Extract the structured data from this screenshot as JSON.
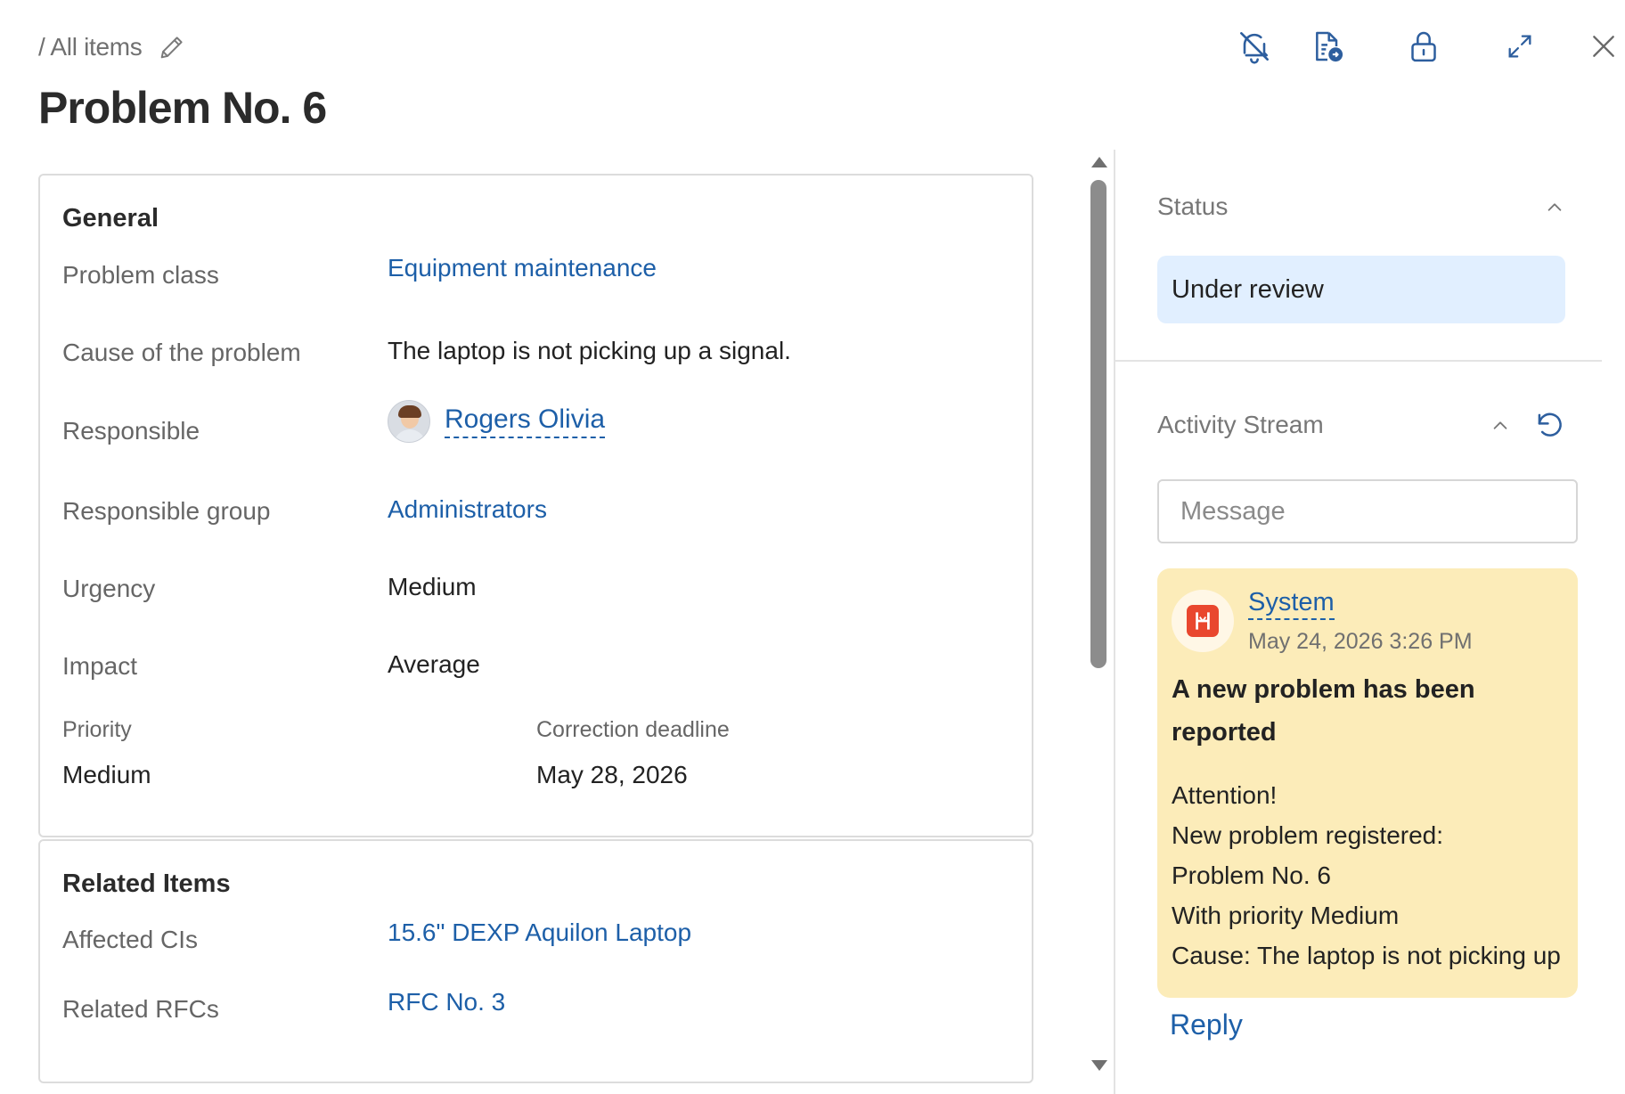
{
  "breadcrumb": {
    "text": "/ All items",
    "edit_icon": "pencil-icon"
  },
  "title": "Problem No. 6",
  "top_actions": [
    "bell-off-icon",
    "file-export-icon",
    "lock-icon",
    "expand-icon",
    "close-icon"
  ],
  "general": {
    "title": "General",
    "problem_class": {
      "label": "Problem class",
      "value": "Equipment maintenance"
    },
    "cause": {
      "label": "Cause of the problem",
      "value": "The laptop is not picking up a signal."
    },
    "responsible": {
      "label": "Responsible",
      "value": "Rogers Olivia"
    },
    "responsible_group": {
      "label": "Responsible group",
      "value": "Administrators"
    },
    "urgency": {
      "label": "Urgency",
      "value": "Medium"
    },
    "impact": {
      "label": "Impact",
      "value": "Average"
    },
    "priority": {
      "label": "Priority",
      "value": "Medium"
    },
    "deadline": {
      "label": "Correction deadline",
      "value": "May 28, 2026"
    }
  },
  "related": {
    "title": "Related Items",
    "affected_cis": {
      "label": "Affected CIs",
      "value": "15.6\" DEXP Aquilon Laptop"
    },
    "related_rfcs": {
      "label": "Related RFCs",
      "value": "RFC No. 3"
    }
  },
  "status": {
    "title": "Status",
    "value": "Under review"
  },
  "activity": {
    "title": "Activity Stream",
    "message_placeholder": "Message",
    "entry": {
      "author": "System",
      "time": "May 24, 2026 3:26 PM",
      "heading": "A new problem has been reported",
      "lines": [
        "Attention!",
        "New problem registered:",
        "Problem No. 6",
        "With priority Medium",
        "Cause: The laptop is not picking up"
      ]
    },
    "reply_label": "Reply"
  },
  "colors": {
    "link": "#1d5fa8",
    "status_bg": "#e1efff",
    "activity_bg": "#fcecb9",
    "system_logo": "#e9472e"
  }
}
